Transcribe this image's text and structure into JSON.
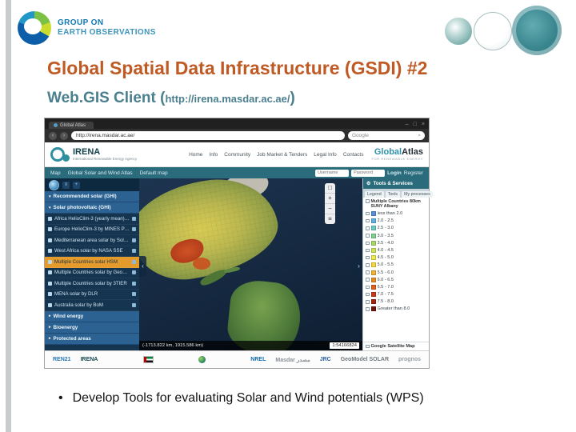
{
  "slide": {
    "logo_line1": "GROUP ON",
    "logo_line2": "EARTH OBSERVATIONS",
    "title": "Global Spatial Data Infrastructure (GSDI) #2",
    "subtitle_prefix": "Web.GIS Client (",
    "subtitle_url": "http://irena.masdar.ac.ae/",
    "subtitle_suffix": ")",
    "bullet": "Develop Tools for evaluating Solar and Wind potentials (WPS)"
  },
  "icons": {
    "minimize": "–",
    "maximize": "□",
    "close": "×",
    "back": "‹",
    "forward": "›",
    "search": "⌕",
    "chevron_down": "▾",
    "chevron_right": "▸",
    "collapse_left": "‹",
    "collapse_right": "›",
    "gear": "⚙",
    "zoom_in": "+",
    "zoom_out": "−",
    "extent": "□",
    "layers": "≡"
  },
  "browser": {
    "tab": "Global Atlas",
    "address": "http://irena.masdar.ac.ae/",
    "search": "Google"
  },
  "site": {
    "brand": "IRENA",
    "brand_sub": "International Renewable Energy Agency",
    "nav": [
      "Home",
      "Info",
      "Community",
      "Job Market & Tenders",
      "Legal Info",
      "Contacts"
    ],
    "atlas_word1": "Global",
    "atlas_word2": "Atlas",
    "atlas_sub": "FOR RENEWABLE ENERGY"
  },
  "menubar": {
    "items": [
      "Map",
      "Global Solar and Wind Atlas",
      "Default map"
    ],
    "username_placeholder": "Username",
    "password_placeholder": "Password",
    "login": "Login",
    "register": "Register"
  },
  "sidebar": {
    "section_recommended": "Recommended solar (GHI)",
    "section_photovoltaic": "Solar photovoltaic (GHI)",
    "items": [
      {
        "label": "Africa HelioClim-3 (yearly mean) by So.."
      },
      {
        "label": "Europe HelioClim-3 by MINES Paris.."
      },
      {
        "label": "Mediterranean area solar by Solar-.."
      },
      {
        "label": "West Africa solar by NASA SSE"
      },
      {
        "label": "Multiple Countries solar HSM",
        "bg": "#e59b2c",
        "fg": "#16324d"
      },
      {
        "label": "Multiple Countries solar by GeoMo.."
      },
      {
        "label": "Multiple Countries solar by 3TIER"
      },
      {
        "label": "MENA solar by DLR"
      },
      {
        "label": "Australia solar by BoM"
      }
    ],
    "collapsed_sections": [
      "Wind energy",
      "Bioenergy",
      "Protected areas"
    ]
  },
  "map": {
    "coordinates": "(-1713.822 km, 1915.586 km)",
    "scale": "1:54166824"
  },
  "tools": {
    "header": "Tools & Services",
    "tabs": [
      "Legend",
      "Tools",
      "My processes"
    ],
    "layer_title": "Multiple Countries 80km SUNY Albany",
    "entries": [
      {
        "label": "less than 2.0",
        "color": "#5b8fd4"
      },
      {
        "label": "2.0 - 2.5",
        "color": "#63aee0"
      },
      {
        "label": "2.5 - 3.0",
        "color": "#6fc8c4"
      },
      {
        "label": "3.0 - 3.5",
        "color": "#7fcf8e"
      },
      {
        "label": "3.5 - 4.0",
        "color": "#a7d867"
      },
      {
        "label": "4.0 - 4.5",
        "color": "#cfe35a"
      },
      {
        "label": "4.5 - 5.0",
        "color": "#eeea4f"
      },
      {
        "label": "5.0 - 5.5",
        "color": "#f4d83e"
      },
      {
        "label": "5.5 - 6.0",
        "color": "#f0b232"
      },
      {
        "label": "6.0 - 6.5",
        "color": "#e98c27"
      },
      {
        "label": "6.5 - 7.0",
        "color": "#df5f1f"
      },
      {
        "label": "7.0 - 7.5",
        "color": "#c93a16"
      },
      {
        "label": "7.5 - 8.0",
        "color": "#a02410"
      },
      {
        "label": "Greater than 8.0",
        "color": "#6f150b"
      }
    ],
    "base_layer": "Google Satellite Map"
  },
  "footer": {
    "logos_left": [
      {
        "text": "REN21",
        "color": "#2a7ab5"
      },
      {
        "text": "IRENA",
        "color": "#10454c"
      }
    ],
    "logos_right": [
      {
        "text": "NREL",
        "color": "#0f6cb0"
      },
      {
        "text": "Masdar مصدر",
        "color": "#8a9097"
      },
      {
        "text": "JRC",
        "color": "#2a5fa5"
      },
      {
        "text": "GeoModel SOLAR",
        "color": "#6f7a80"
      },
      {
        "text": "prognos",
        "color": "#9aa0a5"
      }
    ]
  }
}
